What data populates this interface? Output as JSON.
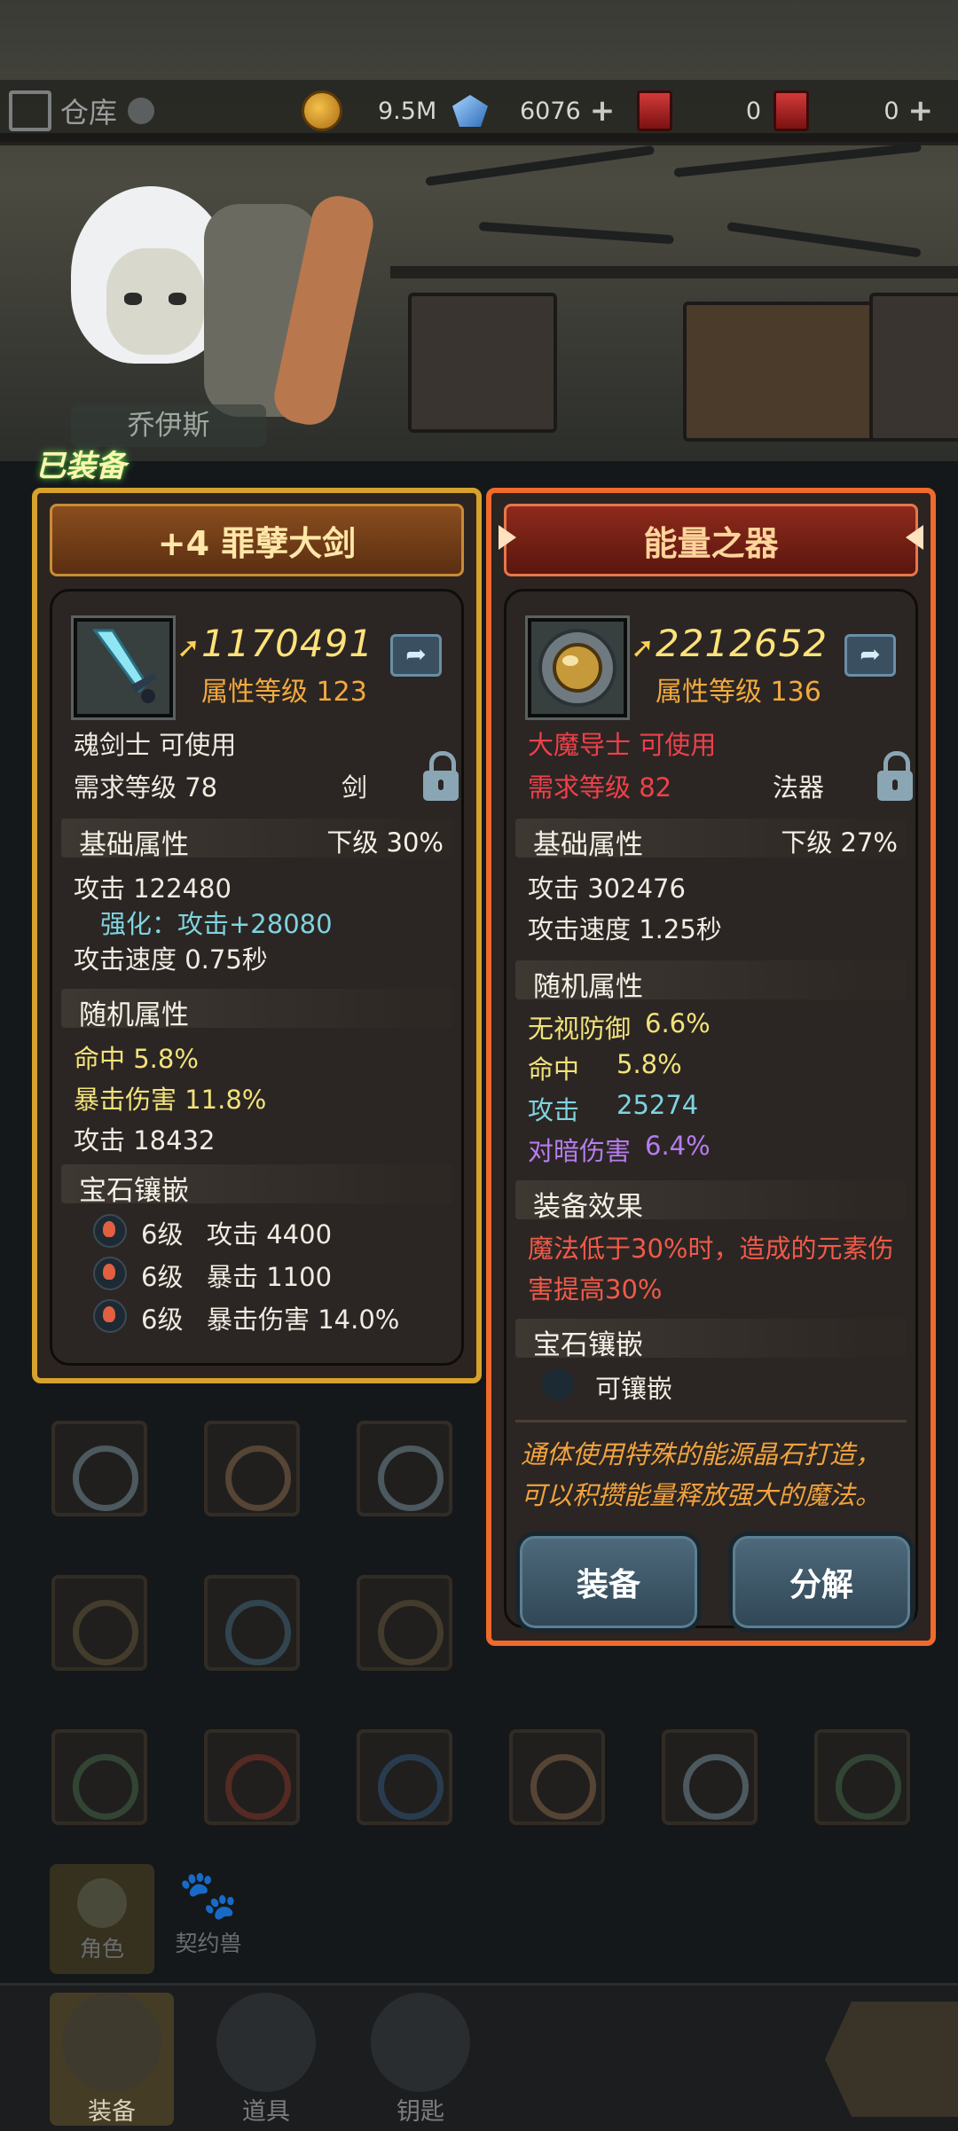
{
  "header": {
    "warehouse_label": "仓库",
    "gold": "9.5M",
    "gems": "6076",
    "ticket1": "0",
    "ticket2": "0"
  },
  "hero": {
    "name": "乔伊斯",
    "equipped_badge": "已装备"
  },
  "equipped_card": {
    "title": "+4 罪孽大剑",
    "power": "1170491",
    "attr_level": "属性等级 123",
    "class_req": "魂剑士 可使用",
    "level_req": "需求等级 78",
    "item_type": "剑",
    "base_section": "基础属性",
    "base_grade": "下级 30%",
    "attack": "攻击  122480",
    "enhance": "强化：攻击+28080",
    "attack_speed": "攻击速度  0.75秒",
    "random_section": "随机属性",
    "random": [
      {
        "text": "命中    5.8%"
      },
      {
        "text": "暴击伤害    11.8%"
      },
      {
        "text": "攻击    18432"
      }
    ],
    "gem_section": "宝石镶嵌",
    "gems": [
      {
        "level": "6级",
        "effect": "攻击 4400"
      },
      {
        "level": "6级",
        "effect": "暴击 1100"
      },
      {
        "level": "6级",
        "effect": "暴击伤害 14.0%"
      }
    ]
  },
  "new_card": {
    "title": "能量之器",
    "power": "2212652",
    "attr_level": "属性等级 136",
    "class_req": "大魔导士 可使用",
    "level_req": "需求等级 82",
    "item_type": "法器",
    "base_section": "基础属性",
    "base_grade": "下级  27%",
    "attack": "攻击  302476",
    "attack_speed": "攻击速度  1.25秒",
    "random_section": "随机属性",
    "random": [
      {
        "label": "无视防御",
        "value": "6.6%",
        "color": "#f2e27a"
      },
      {
        "label": "命中",
        "value": "5.8%",
        "color": "#f2e27a"
      },
      {
        "label": "攻击",
        "value": "25274",
        "color": "#7fd3e0"
      },
      {
        "label": "对暗伤害",
        "value": "6.4%",
        "color": "#b77cf0"
      }
    ],
    "effect_section": "装备效果",
    "effect_text_1": "魔法低于30%时，造成的元素伤",
    "effect_text_2": "害提高30%",
    "gem_section": "宝石镶嵌",
    "gem_slot": "可镶嵌",
    "flavor_1": "通体使用特殊的能源晶石打造，",
    "flavor_2": "可以积攒能量释放强大的魔法。",
    "equip_button": "装备",
    "dismantle_button": "分解"
  },
  "side_tabs": {
    "character": "角色",
    "pet": "契约兽"
  },
  "bottom_nav": {
    "equip": "装备",
    "items": "道具",
    "key": "钥匙"
  },
  "colors": {
    "gold_border": "#d6a22c",
    "orange_border": "#ef6a2c",
    "red_req": "#f0404a",
    "blue_text": "#7fd3e0"
  }
}
